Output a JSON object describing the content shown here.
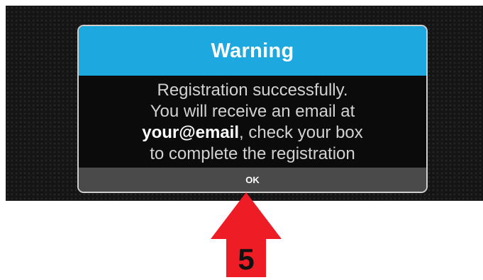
{
  "dialog": {
    "title": "Warning",
    "lines": [
      "Registration successfully.",
      "You will receive an email at",
      ", check your box",
      "to complete the registration"
    ],
    "email": "your@email",
    "ok_label": "OK"
  },
  "annotation": {
    "step_number": "5",
    "arrow_color": "#ee1c24"
  },
  "colors": {
    "header": "#1ea8e0",
    "footer": "#4a4a4a",
    "background": "#151515"
  }
}
